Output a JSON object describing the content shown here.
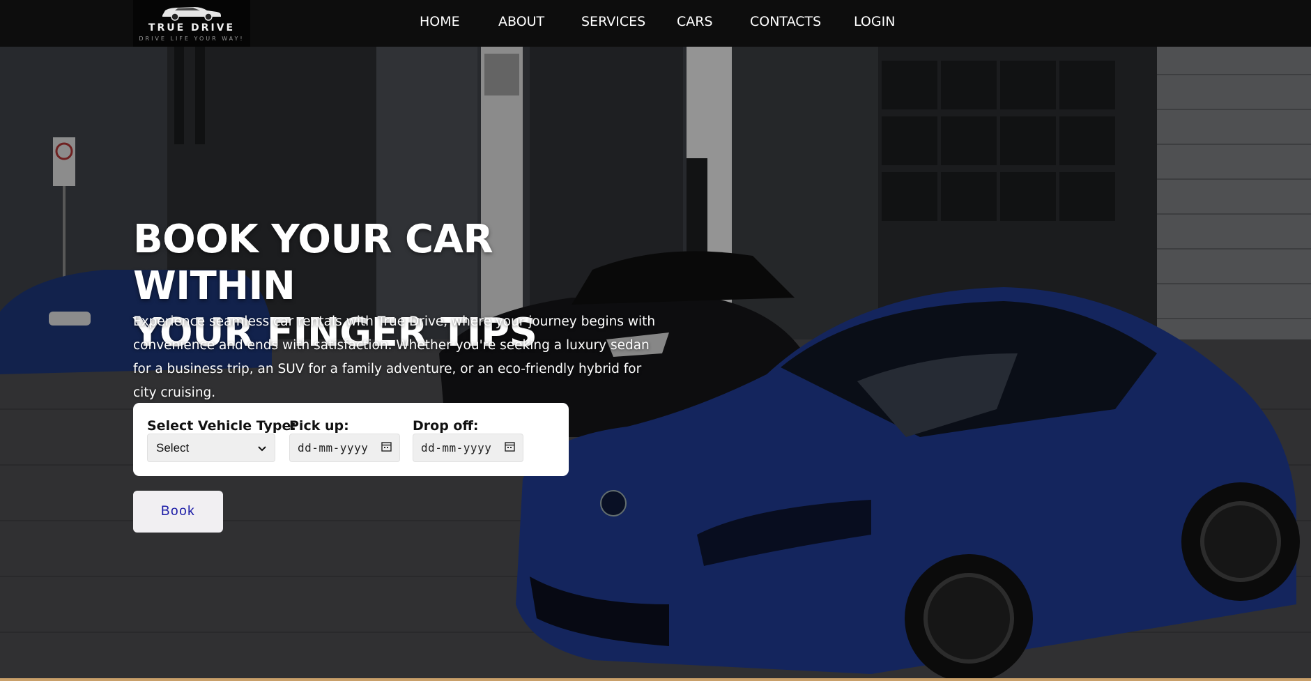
{
  "brand": {
    "name": "TRUE DRIVE",
    "tagline": "DRIVE LIFE YOUR WAY!"
  },
  "nav": {
    "items": [
      {
        "label": "HOME"
      },
      {
        "label": "ABOUT"
      },
      {
        "label": "SERVICES"
      },
      {
        "label": "CARS"
      },
      {
        "label": "CONTACTS"
      },
      {
        "label": "LOGIN"
      }
    ]
  },
  "hero": {
    "title_line1": "BOOK YOUR CAR WITHIN",
    "title_line2": "YOUR FINGER TIPS",
    "description": "Experience seamless car rentals with True Drive, where your journey begins with convenience and ends with satisfaction. Whether you're seeking a luxury sedan for a business trip, an SUV for a family adventure, or an eco-friendly hybrid for city cruising."
  },
  "booking": {
    "vehicle_label": "Select Vehicle Type:",
    "vehicle_value": "Select",
    "pickup_label": "Pick up:",
    "pickup_placeholder": "dd-mm-yyyy",
    "dropoff_label": "Drop off:",
    "dropoff_placeholder": "dd-mm-yyyy",
    "book_label": "Book"
  },
  "colors": {
    "nav_bg": "#0d0d0d",
    "book_text": "#1a1aa6",
    "car_blue": "#1f3a8f"
  }
}
